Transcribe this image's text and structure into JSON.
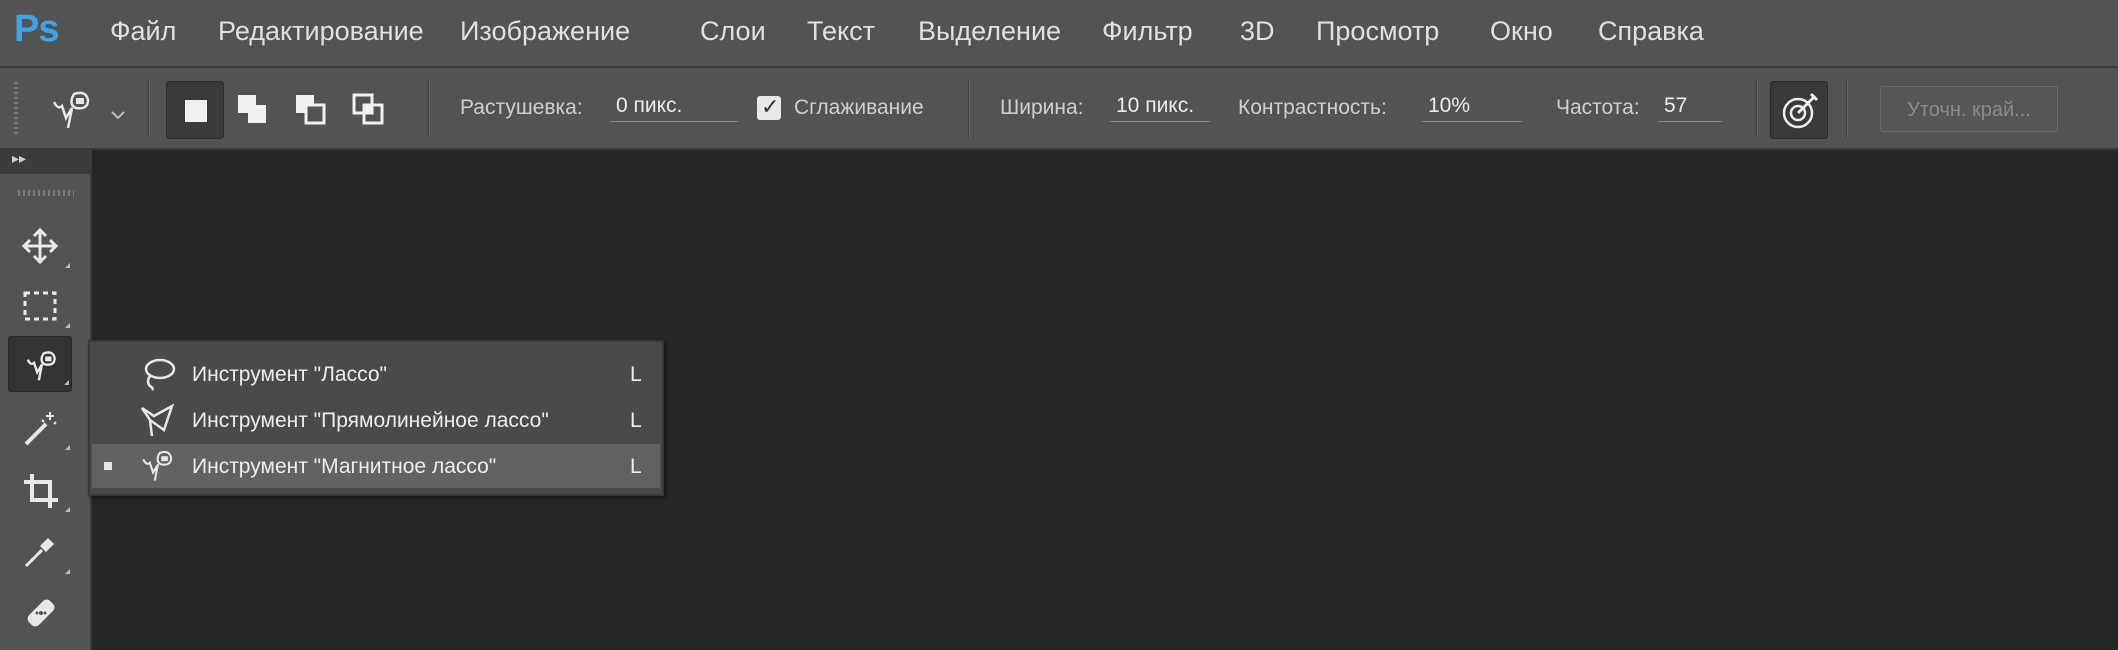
{
  "app": {
    "logo": "Ps"
  },
  "menu": [
    "Файл",
    "Редактирование",
    "Изображение",
    "Слои",
    "Текст",
    "Выделение",
    "Фильтр",
    "3D",
    "Просмотр",
    "Окно",
    "Справка"
  ],
  "options": {
    "feather_label": "Растушевка:",
    "feather_value": "0 пикс.",
    "antialias_label": "Сглаживание",
    "antialias_checked": true,
    "width_label": "Ширина:",
    "width_value": "10 пикс.",
    "contrast_label": "Контрастность:",
    "contrast_value": "10%",
    "frequency_label": "Частота:",
    "frequency_value": "57",
    "refine_edge_label": "Уточн. край...",
    "selection_modes": [
      "new-selection-icon",
      "add-to-selection-icon",
      "subtract-from-selection-icon",
      "intersect-selection-icon"
    ]
  },
  "toolbar": {
    "tools": [
      "move-tool-icon",
      "marquee-tool-icon",
      "magnetic-lasso-tool-icon",
      "magic-wand-tool-icon",
      "crop-tool-icon",
      "eyedropper-tool-icon",
      "healing-brush-tool-icon"
    ],
    "active_tool": "magnetic-lasso-tool-icon"
  },
  "flyout": {
    "items": [
      {
        "label": "Инструмент \"Лассо\"",
        "shortcut": "L",
        "icon": "lasso-icon",
        "selected": false
      },
      {
        "label": "Инструмент \"Прямолинейное лассо\"",
        "shortcut": "L",
        "icon": "polygonal-lasso-icon",
        "selected": false
      },
      {
        "label": "Инструмент \"Магнитное лассо\"",
        "shortcut": "L",
        "icon": "magnetic-lasso-icon",
        "selected": true
      }
    ]
  },
  "colors": {
    "menubar": "#535353",
    "canvas": "#262626",
    "logo": "#3ea4e6",
    "flyout_selected": "#626262"
  }
}
